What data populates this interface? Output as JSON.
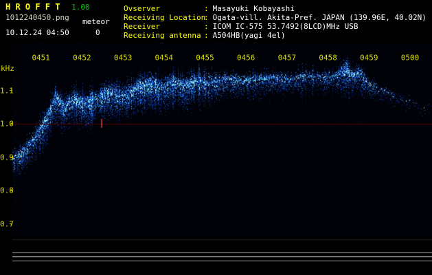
{
  "app": {
    "title": "H R O F F T",
    "version": "1.00",
    "filename": "1012240450.png",
    "meteor_label": "meteor",
    "meteor_count": "0",
    "timestamp": "10.12.24 04:50"
  },
  "info_separator": ":",
  "info": [
    {
      "label": "Ovserver",
      "value": "Masayuki Kobayashi"
    },
    {
      "label": "Receiving Location",
      "value": "Ogata-vill. Akita-Pref. JAPAN (139.96E, 40.02N)"
    },
    {
      "label": "Receiver",
      "value": "ICOM IC-575 53.7492(8LCD)MHz USB"
    },
    {
      "label": "Receiving antenna",
      "value": "A504HB(yagi 4el)"
    }
  ],
  "chart_data": {
    "type": "heatmap",
    "subtype": "radio-meteor-spectrogram",
    "title": "",
    "xlabel": "",
    "ylabel": "kHz",
    "x_ticks": [
      {
        "label": "0451",
        "minute": 1
      },
      {
        "label": "0452",
        "minute": 2
      },
      {
        "label": "0453",
        "minute": 3
      },
      {
        "label": "0454",
        "minute": 4
      },
      {
        "label": "0455",
        "minute": 5
      },
      {
        "label": "0456",
        "minute": 6
      },
      {
        "label": "0457",
        "minute": 7
      },
      {
        "label": "0458",
        "minute": 8
      },
      {
        "label": "0459",
        "minute": 9
      },
      {
        "label": "0500",
        "minute": 10
      }
    ],
    "y_ticks": [
      {
        "label": "1.1",
        "value": 1.1
      },
      {
        "label": "1.0",
        "value": 1.0
      },
      {
        "label": "0.9",
        "value": 0.9
      },
      {
        "label": "0.8",
        "value": 0.8
      },
      {
        "label": "0.7",
        "value": 0.7
      }
    ],
    "ylim": [
      0.66,
      1.24
    ],
    "x_range_minutes": [
      0,
      10.55
    ],
    "grid": false,
    "carrier_line_khz": 1.0,
    "noise_ridge": {
      "description": "Drifting noise band: starts near 0.89 kHz at 04:50, rises to ~1.1-1.14 kHz by 04:52, dense until ~04:55, sparse after, burst near 04:58.5, fades toward 05:00",
      "x_minutes": [
        0.25,
        0.5,
        0.8,
        1.1,
        1.35,
        1.55,
        1.8,
        2.1,
        2.4,
        2.7,
        3.0,
        3.3,
        3.6,
        3.9,
        4.2,
        4.5,
        4.8,
        5.1,
        5.5,
        5.9,
        6.3,
        6.7,
        7.1,
        7.5,
        7.9,
        8.2,
        8.45,
        8.6,
        8.75,
        8.95,
        9.3,
        9.7,
        10.3
      ],
      "center_khz": [
        0.885,
        0.905,
        0.945,
        1.0,
        1.075,
        1.045,
        1.07,
        1.055,
        1.075,
        1.09,
        1.08,
        1.1,
        1.115,
        1.105,
        1.12,
        1.11,
        1.125,
        1.12,
        1.13,
        1.125,
        1.13,
        1.135,
        1.13,
        1.14,
        1.135,
        1.14,
        1.16,
        1.14,
        1.15,
        1.12,
        1.1,
        1.08,
        1.05
      ],
      "intensity": [
        0.5,
        0.55,
        0.65,
        0.85,
        1.0,
        0.85,
        0.95,
        0.85,
        0.9,
        0.95,
        0.9,
        1.0,
        0.95,
        0.9,
        0.95,
        0.85,
        0.8,
        0.65,
        0.55,
        0.5,
        0.45,
        0.4,
        0.35,
        0.32,
        0.36,
        0.5,
        1.0,
        0.7,
        0.8,
        0.35,
        0.15,
        0.08,
        0.03
      ]
    },
    "colors": {
      "background": "#000000",
      "plot_background": "#010208",
      "noise_blue": "#1a46ff",
      "axis_label": "#d8d800",
      "header_label": "#ffff00",
      "header_value": "#ffffff",
      "version_green": "#00cc00",
      "carrier_line": "#520000",
      "carrier_blip": "#a03030",
      "meter_line_bright": "#e6e6e6",
      "meter_line_dim": "#8a8a8a"
    }
  }
}
